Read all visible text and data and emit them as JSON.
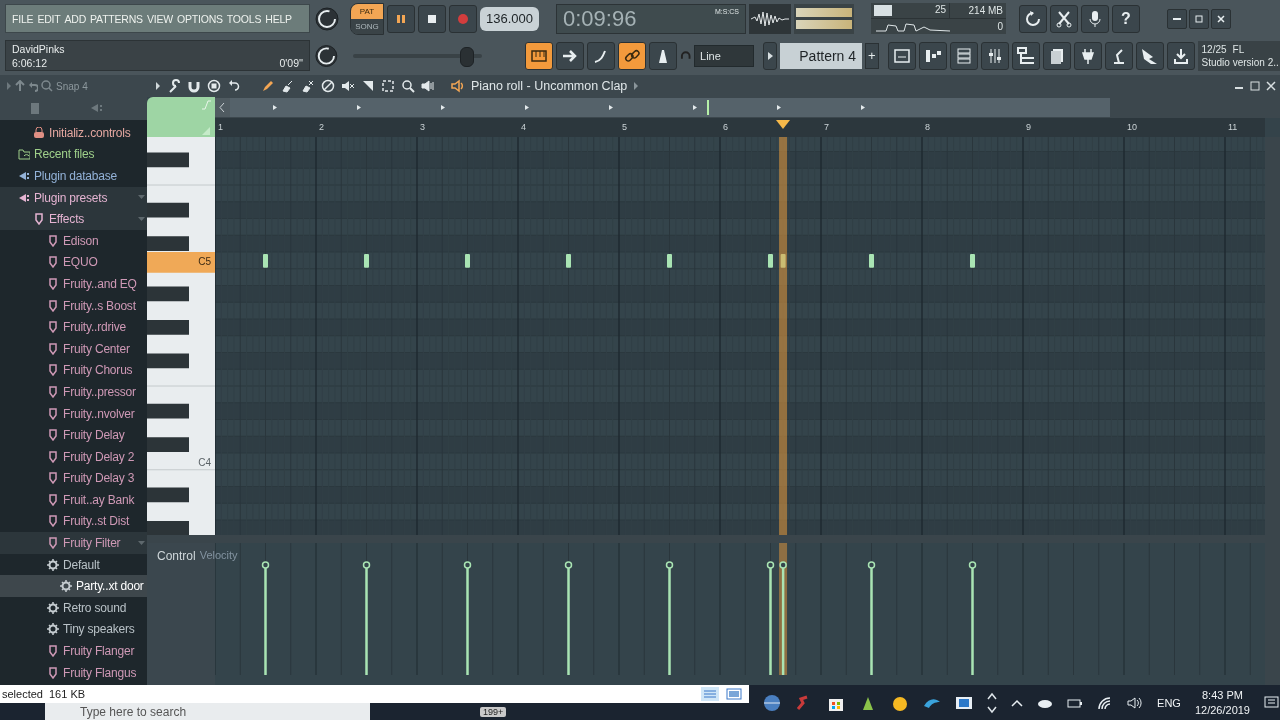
{
  "menu": [
    "FILE",
    "EDIT",
    "ADD",
    "PATTERNS",
    "VIEW",
    "OPTIONS",
    "TOOLS",
    "HELP"
  ],
  "hint_bar": {
    "user": "DavidPinks",
    "time": "6:06:12",
    "duration": "0'09''"
  },
  "transport": {
    "modes": [
      {
        "label": "PAT",
        "selected": true
      },
      {
        "label": "SONG",
        "selected": false
      }
    ],
    "playing": true,
    "recording": false,
    "tempo": "136.000"
  },
  "pitch_slider": {
    "level": 0.88
  },
  "time_display": {
    "value": "0:09:96",
    "unit": "M:S:CS"
  },
  "cpu_monitor": {
    "polyphony": "25",
    "memory": "214 MB",
    "voices": "0",
    "level": 0.25
  },
  "pattern_tools": [
    {
      "active": true
    },
    {
      "active": false
    },
    {
      "active": false
    },
    {
      "active": true
    },
    {
      "active": false
    }
  ],
  "snap_mode": "Line",
  "pattern": {
    "name": "Pattern 4",
    "add": "+"
  },
  "help_label": "?",
  "news": {
    "date": "12/25",
    "brand": "FL",
    "text": "Studio version 2.."
  },
  "browser": {
    "snap": "Snap 4",
    "tree": [
      {
        "kind": "template",
        "label": "Initializ..controls",
        "selected": false
      },
      {
        "kind": "recent",
        "label": "Recent files",
        "selected": false
      },
      {
        "kind": "database",
        "label": "Plugin database",
        "selected": false
      },
      {
        "kind": "presets",
        "label": "Plugin presets",
        "selected": false,
        "expanded": true,
        "children": [
          {
            "kind": "category",
            "label": "Effects",
            "selected": false,
            "expanded": true,
            "children": [
              {
                "kind": "plugin",
                "label": "Edison",
                "selected": false
              },
              {
                "kind": "plugin",
                "label": "EQUO",
                "selected": false
              },
              {
                "kind": "plugin",
                "label": "Fruity..and EQ",
                "selected": false
              },
              {
                "kind": "plugin",
                "label": "Fruity..s Boost",
                "selected": false
              },
              {
                "kind": "plugin",
                "label": "Fruity..rdrive",
                "selected": false
              },
              {
                "kind": "plugin",
                "label": "Fruity Center",
                "selected": false
              },
              {
                "kind": "plugin",
                "label": "Fruity Chorus",
                "selected": false
              },
              {
                "kind": "plugin",
                "label": "Fruity..pressor",
                "selected": false
              },
              {
                "kind": "plugin",
                "label": "Fruity..nvolver",
                "selected": false
              },
              {
                "kind": "plugin",
                "label": "Fruity Delay",
                "selected": false
              },
              {
                "kind": "plugin",
                "label": "Fruity Delay 2",
                "selected": false
              },
              {
                "kind": "plugin",
                "label": "Fruity Delay 3",
                "selected": false
              },
              {
                "kind": "plugin",
                "label": "Fruit..ay Bank",
                "selected": false
              },
              {
                "kind": "plugin",
                "label": "Fruity..st Dist",
                "selected": false
              },
              {
                "kind": "plugin",
                "label": "Fruity Filter",
                "selected": false,
                "expanded": true,
                "children": [
                  {
                    "kind": "preset",
                    "label": "Default",
                    "selected": false,
                    "children": [
                      {
                        "kind": "preset",
                        "label": "Party..xt door",
                        "selected": true
                      }
                    ]
                  },
                  {
                    "kind": "preset",
                    "label": "Retro sound",
                    "selected": false
                  },
                  {
                    "kind": "preset",
                    "label": "Tiny speakers",
                    "selected": false
                  }
                ]
              },
              {
                "kind": "plugin",
                "label": "Fruity Flanger",
                "selected": false
              },
              {
                "kind": "plugin",
                "label": "Fruity Flangus",
                "selected": false
              }
            ]
          }
        ]
      }
    ]
  },
  "piano_roll": {
    "title": "Piano roll - Uncommon Clap",
    "ruler": [
      "1",
      "2",
      "3",
      "4",
      "5",
      "6",
      "7",
      "8",
      "9",
      "10",
      "11"
    ],
    "keys": [
      {
        "label": "C5",
        "selected": true
      },
      {
        "label": "C4",
        "selected": false
      }
    ],
    "playhead": {
      "level": 0.541
    },
    "control": {
      "label": "Control",
      "parameter": "Velocity"
    }
  },
  "status": {
    "text": "selected",
    "size": "161 KB"
  },
  "taskbar": {
    "search_placeholder": "Type here to search",
    "badge": "199+",
    "language": "ENG",
    "time": "8:43 PM",
    "date": "12/26/2019"
  }
}
